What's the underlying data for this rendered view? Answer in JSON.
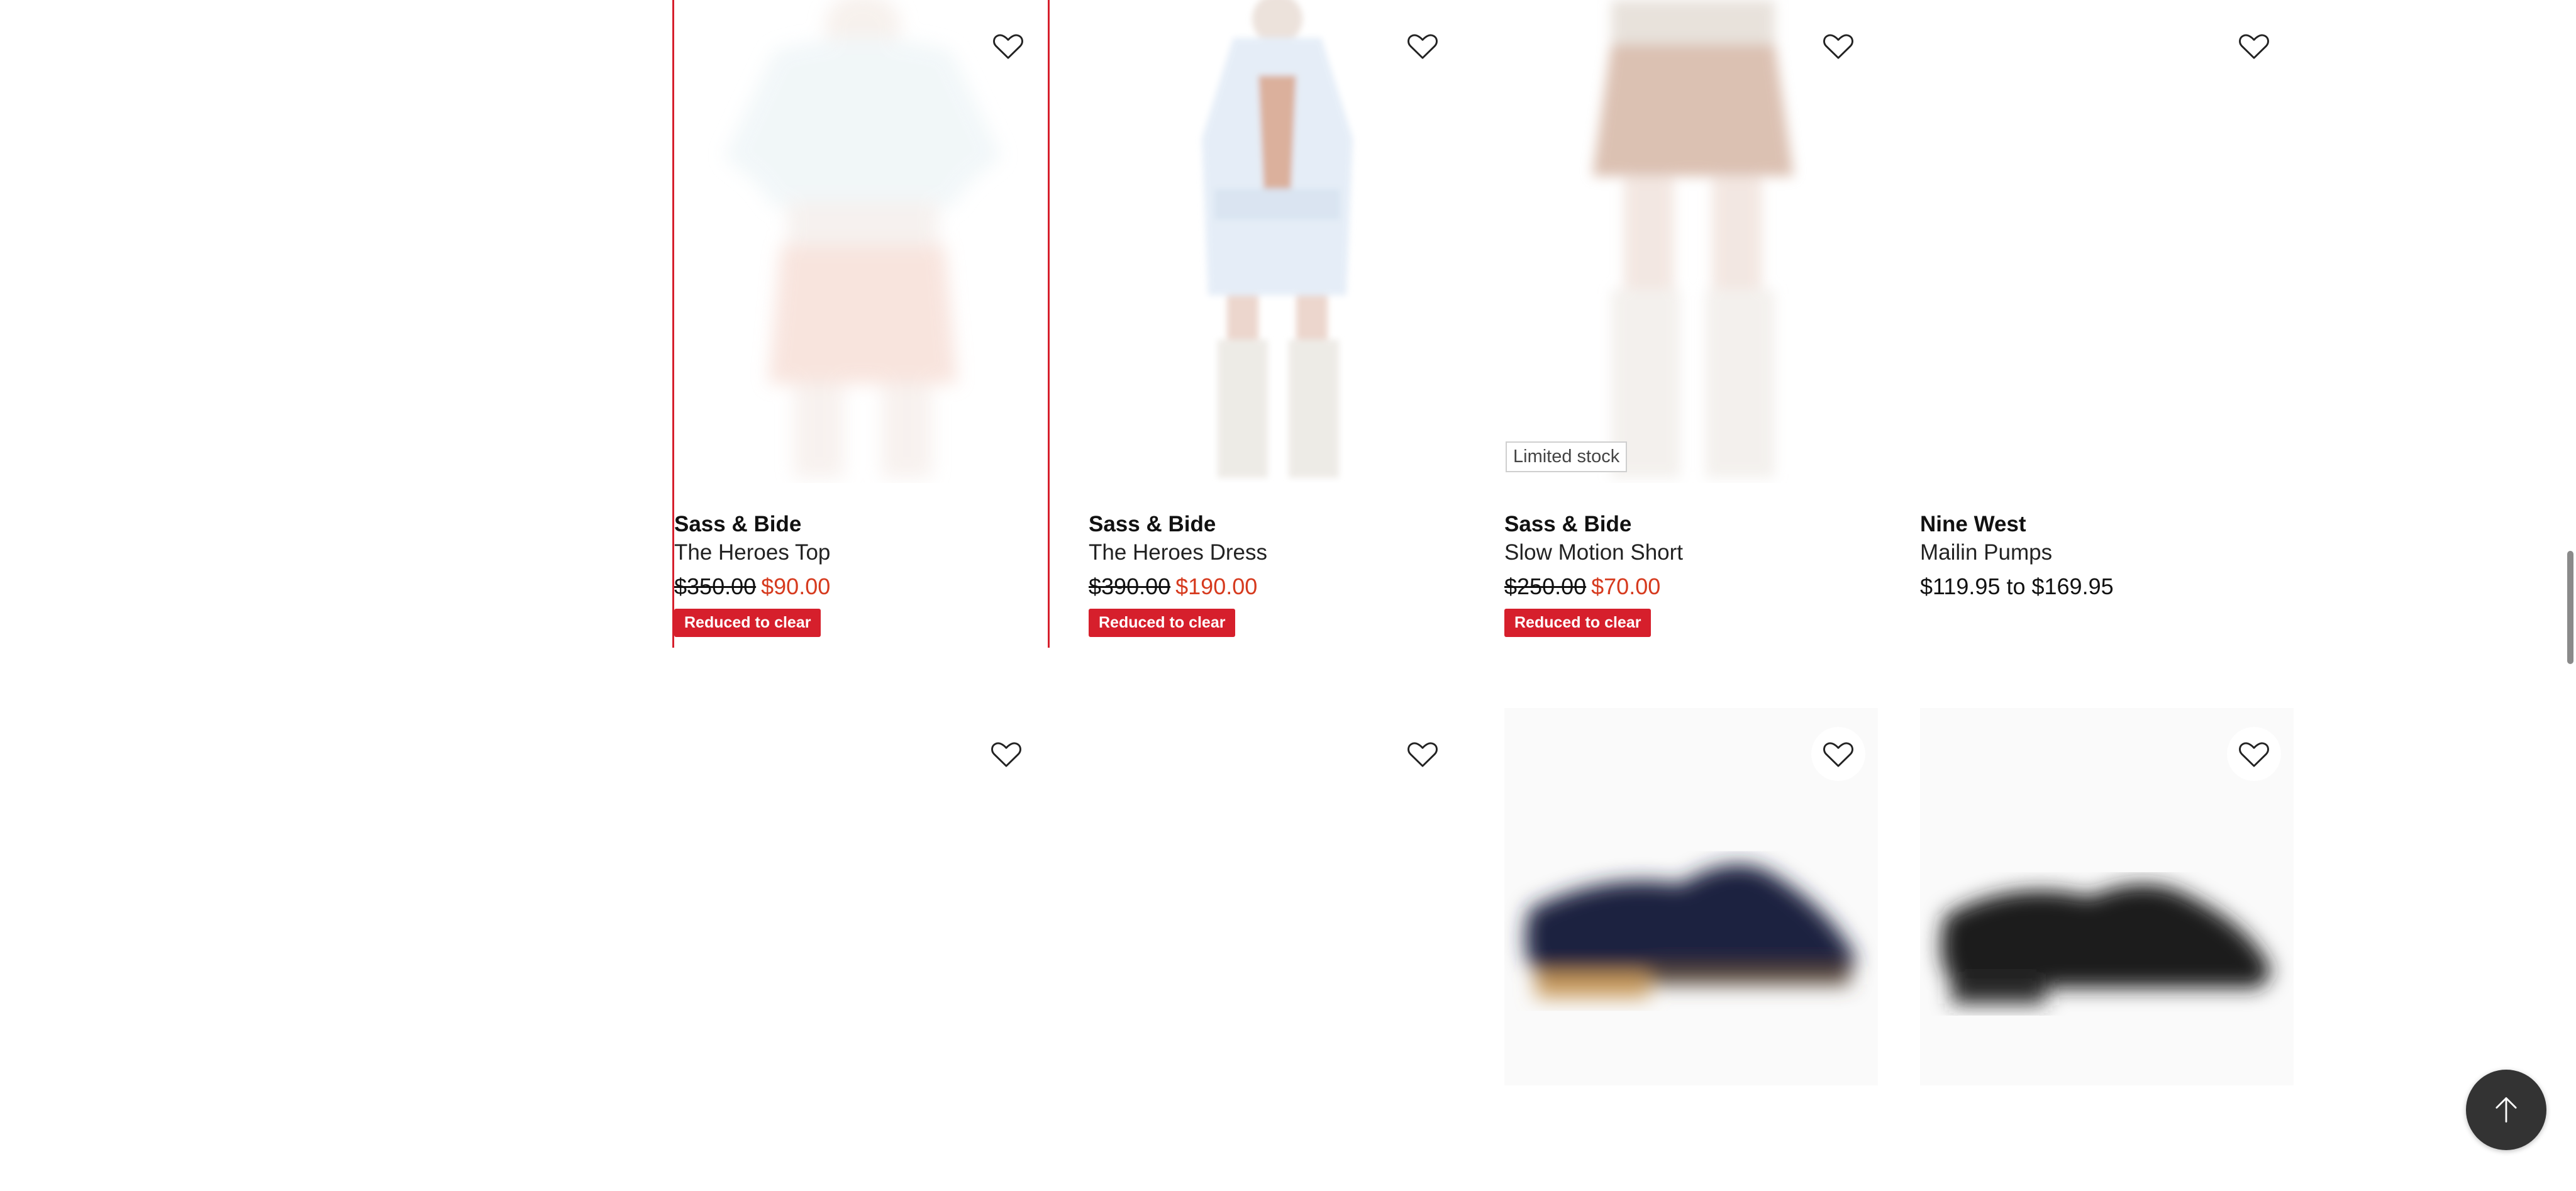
{
  "products": [
    {
      "brand": "Sass & Bide",
      "name": "The Heroes Top",
      "was_price": "$350.00",
      "now_price": "$90.00",
      "badge": "Reduced to clear",
      "image": "the-heroes-top-photo"
    },
    {
      "brand": "Sass & Bide",
      "name": "The Heroes Dress",
      "was_price": "$390.00",
      "now_price": "$190.00",
      "badge": "Reduced to clear",
      "image": "the-heroes-dress-photo"
    },
    {
      "brand": "Sass & Bide",
      "name": "Slow Motion Short",
      "was_price": "$250.00",
      "now_price": "$70.00",
      "badge": "Reduced to clear",
      "stock_label": "Limited stock",
      "image": "slow-motion-short-photo"
    },
    {
      "brand": "Nine West",
      "name": "Mailin Pumps",
      "price_range": "$119.95 to $169.95",
      "image": "mailin-pumps-photo"
    }
  ],
  "second_row": [
    {
      "image": "blank-product-photo"
    },
    {
      "image": "blank-product-photo"
    },
    {
      "image": "blue-loafer-photo"
    },
    {
      "image": "black-loafer-photo"
    }
  ],
  "icons": {
    "wishlist": "heart-outline-icon",
    "back_to_top": "arrow-up-icon"
  },
  "colors": {
    "sale_red": "#d63a1e",
    "badge_red": "#d61f2c",
    "back_to_top_bg": "#333333"
  }
}
